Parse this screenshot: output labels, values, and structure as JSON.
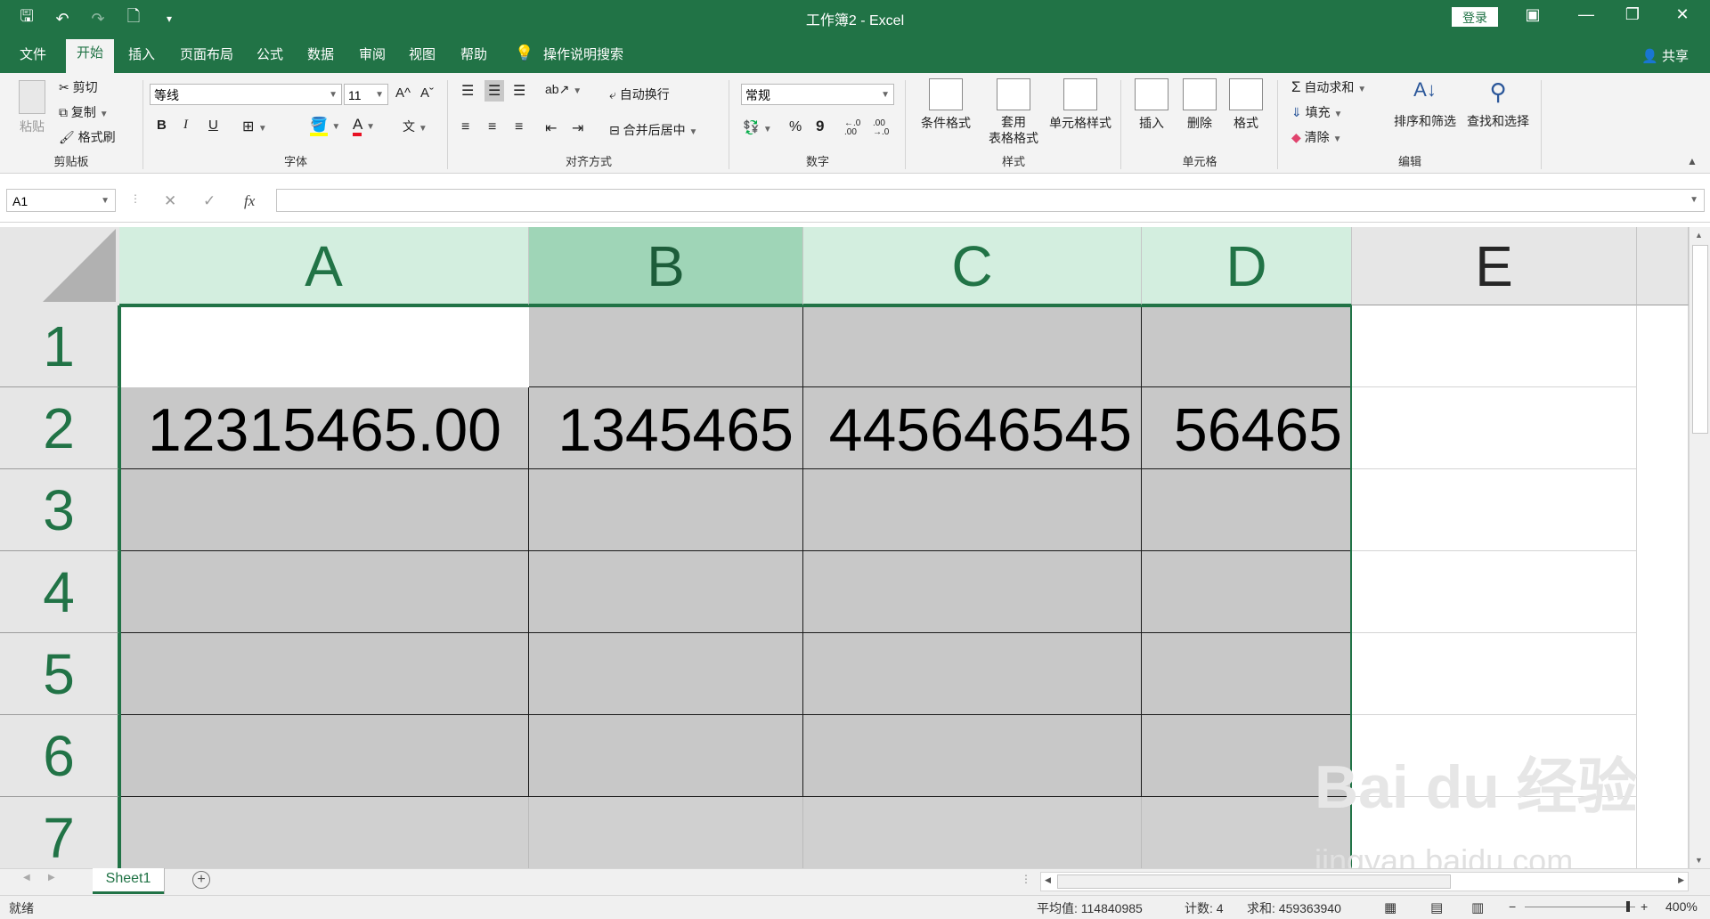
{
  "window": {
    "title": "工作簿2  -  Excel",
    "login": "登录",
    "minimize_icon": "—",
    "restore_icon": "❐",
    "close_icon": "✕",
    "ribbon_display_icon": "▣"
  },
  "qat": {
    "save_icon": "🖫",
    "undo_icon": "↶",
    "redo_icon": "↷",
    "print_preview_icon": "🗋",
    "customize_icon": "▾"
  },
  "menu": {
    "tabs": [
      "文件",
      "开始",
      "插入",
      "页面布局",
      "公式",
      "数据",
      "审阅",
      "视图",
      "帮助"
    ],
    "active_tab": "开始",
    "tell_me": "操作说明搜索",
    "share": "共享"
  },
  "ribbon": {
    "clipboard": {
      "label": "剪贴板",
      "paste": "粘贴",
      "cut": "剪切",
      "copy": "复制",
      "format_painter": "格式刷"
    },
    "font": {
      "label": "字体",
      "font_name": "等线",
      "font_size": "11",
      "bold": "B",
      "italic": "I",
      "underline": "U",
      "grow": "A^",
      "shrink": "Aˇ",
      "font_color_glyph": "A",
      "font_color": "#e81123",
      "phonetic": "文"
    },
    "alignment": {
      "label": "对齐方式",
      "wrap": "自动换行",
      "merge": "合并后居中"
    },
    "number": {
      "label": "数字",
      "format": "常规",
      "percent": "%",
      "comma": "9",
      "inc_decimal": "←.0 .00",
      "dec_decimal": ".00 →.0"
    },
    "styles": {
      "label": "样式",
      "conditional": "条件格式",
      "table_format_1": "套用",
      "table_format_2": "表格格式",
      "cell_styles": "单元格样式"
    },
    "cells": {
      "label": "单元格",
      "insert": "插入",
      "delete": "删除",
      "format": "格式"
    },
    "editing": {
      "label": "编辑",
      "autosum": "自动求和",
      "fill": "填充",
      "clear": "清除",
      "sort_filter": "排序和筛选",
      "find_select": "查找和选择"
    }
  },
  "formula_bar": {
    "name_box": "A1",
    "cancel": "✕",
    "enter": "✓",
    "fx": "fx",
    "formula": ""
  },
  "sheet": {
    "columns": [
      "A",
      "B",
      "C",
      "D",
      "E"
    ],
    "rows": [
      "1",
      "2",
      "3",
      "4",
      "5",
      "6",
      "7"
    ],
    "row2": [
      "12315465.00",
      "1345465",
      "445646545",
      "56465"
    ],
    "tab": "Sheet1"
  },
  "status": {
    "ready": "就绪",
    "average": "平均值: 114840985",
    "count": "计数: 4",
    "sum": "求和: 459363940",
    "zoom": "400%"
  },
  "watermark": {
    "brand": "Bai du 经验",
    "url": "jingyan.baidu.com"
  },
  "colors": {
    "accent": "#217346",
    "selected_header": "#d3eedf",
    "selected_range": "#c8c8c8"
  }
}
